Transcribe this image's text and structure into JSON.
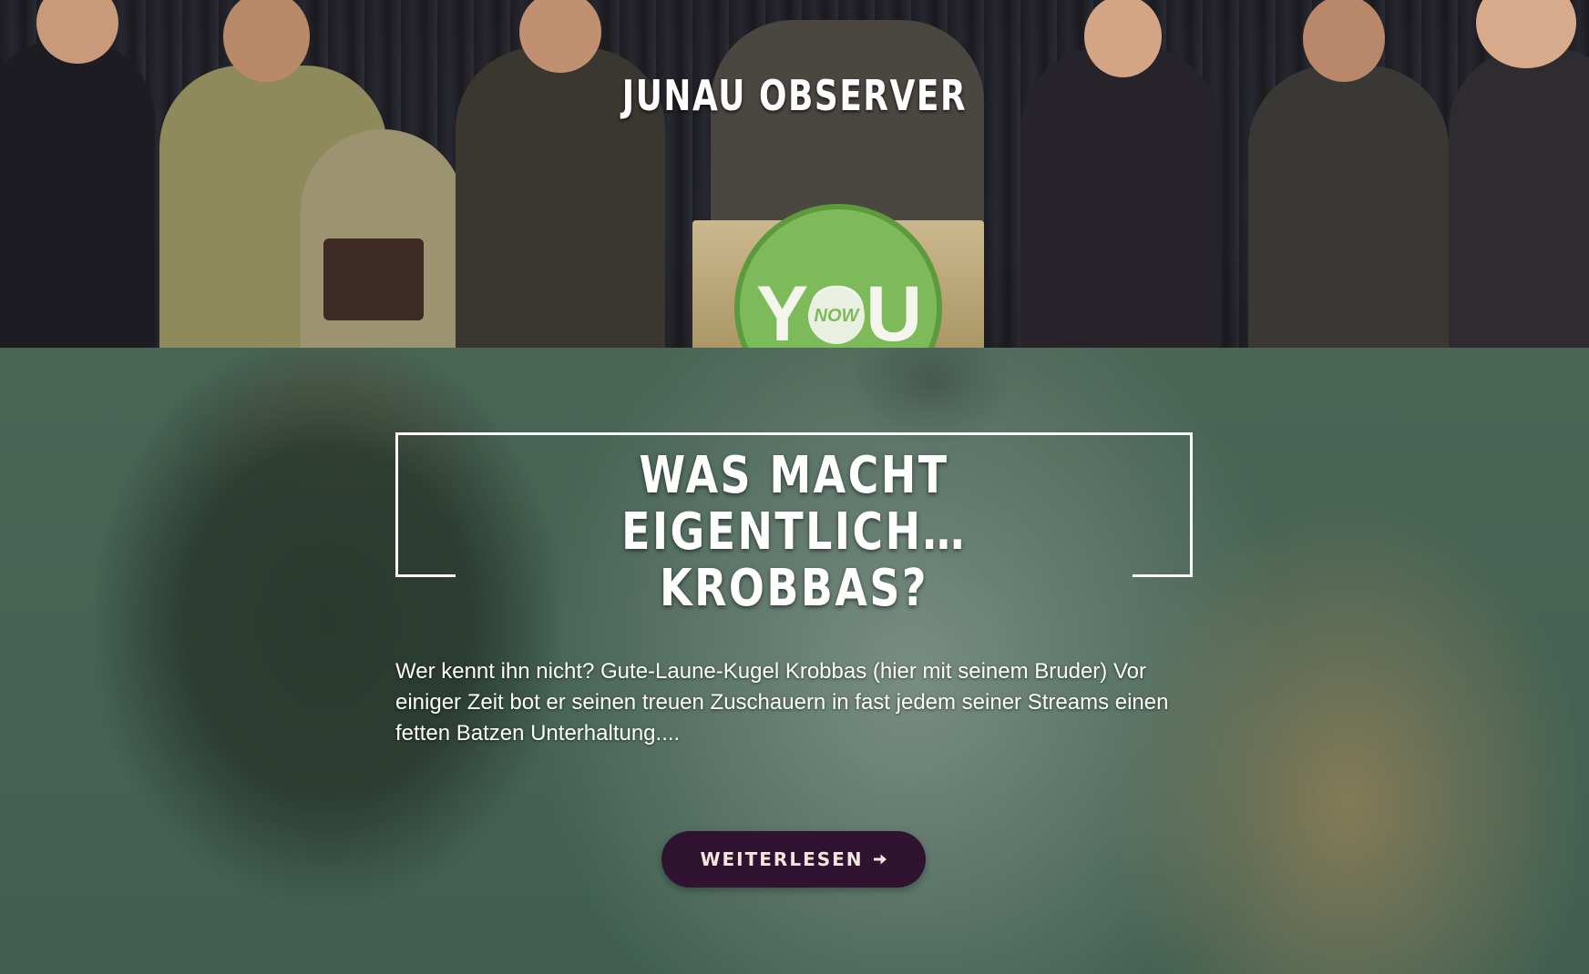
{
  "site": {
    "title": "JUNAU OBSERVER"
  },
  "hero": {
    "sign_text": "YOU",
    "sign_badge": "NOW"
  },
  "article": {
    "headline_line1": "WAS MACHT EIGENTLICH…",
    "headline_line2": "KROBBAS?",
    "excerpt": "Wer kennt ihn nicht? Gute-Laune-Kugel Krobbas (hier mit seinem Bruder) Vor einiger Zeit bot er seinen treuen Zuschauern in fast jedem seiner Streams einen fetten Batzen Unterhaltung....",
    "read_more_label": "WEITERLESEN",
    "read_more_icon": "arrow-right-icon"
  },
  "colors": {
    "button_bg": "#2f1330",
    "button_text": "#f4e6dc",
    "section_tint": "#2a4a3c",
    "sign_green": "#7dbb5a"
  }
}
